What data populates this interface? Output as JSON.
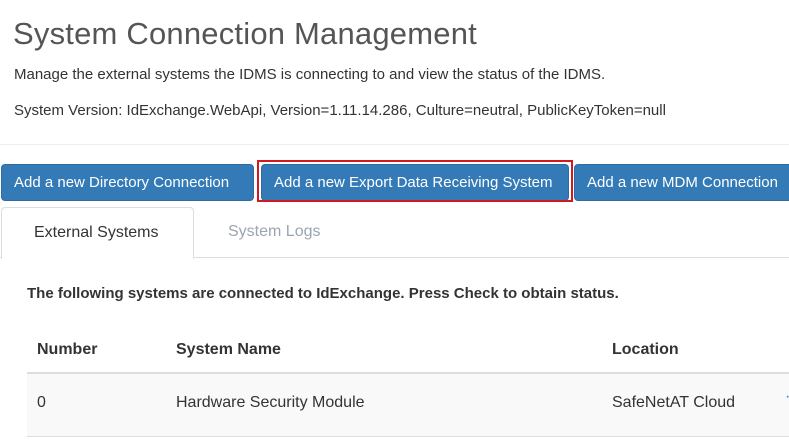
{
  "header": {
    "title": "System Connection Management",
    "description": "Manage the external systems the IDMS is connecting to and view the status of the IDMS.",
    "version": "System Version: IdExchange.WebApi, Version=1.11.14.286, Culture=neutral, PublicKeyToken=null"
  },
  "toolbar": {
    "add_directory_label": "Add a new Directory Connection",
    "add_export_label": "Add a new Export Data Receiving System",
    "add_mdm_label": "Add a new MDM Connection",
    "highlight_color": "#d2191f",
    "button_color": "#337ab7"
  },
  "tabs": [
    {
      "label": "External Systems",
      "active": true
    },
    {
      "label": "System Logs",
      "active": false
    }
  ],
  "panel": {
    "note": "The following systems are connected to IdExchange. Press Check to obtain status."
  },
  "table": {
    "columns": [
      "Number",
      "System Name",
      "Location"
    ],
    "rows": [
      {
        "number": "0",
        "system_name": "Hardware Security Module",
        "location": "SafeNetAT Cloud"
      }
    ]
  }
}
